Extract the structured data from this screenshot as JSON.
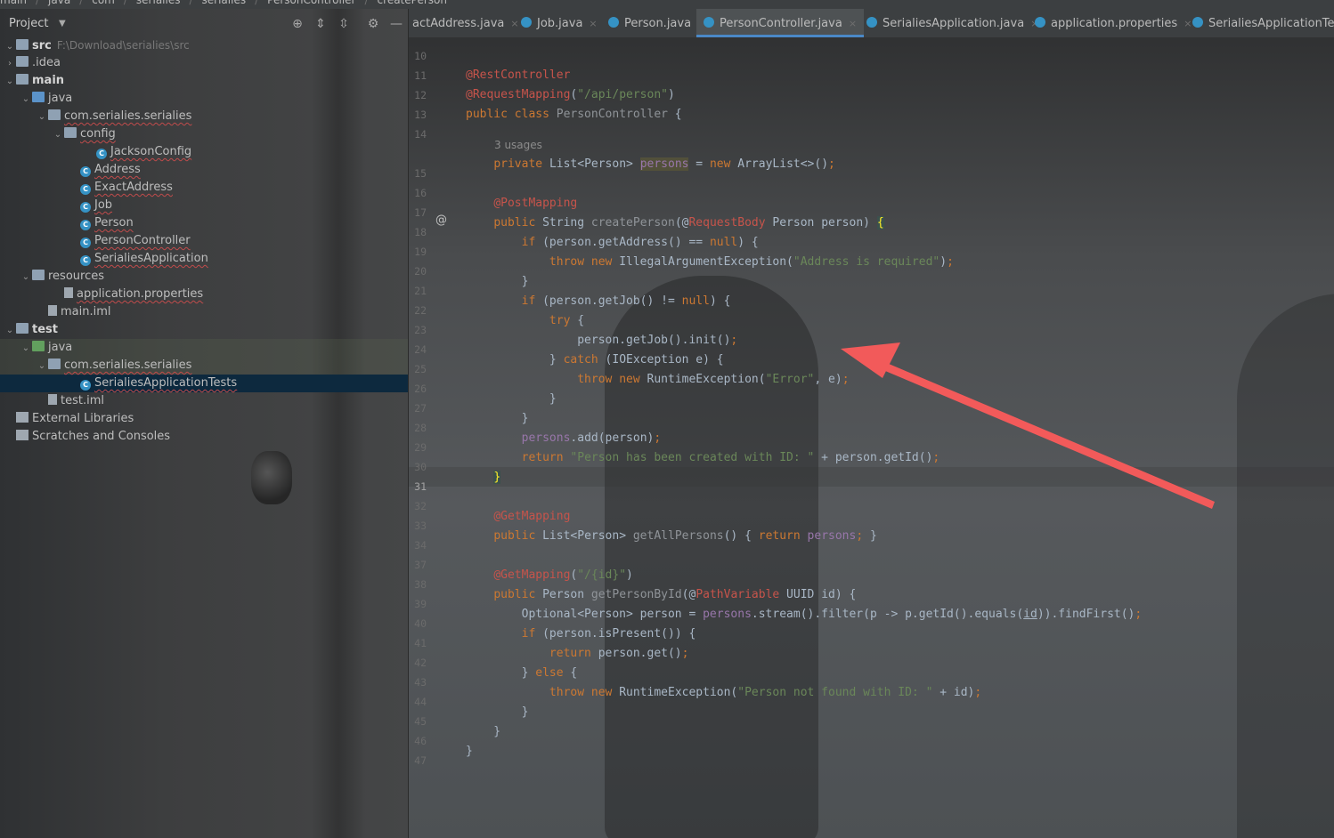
{
  "breadcrumbs": [
    "main",
    "java",
    "com",
    "serialies",
    "serialies",
    "PersonController",
    "createPerson"
  ],
  "project_panel": {
    "title": "Project",
    "tree": [
      {
        "label": "src",
        "path": "F:\\Download\\serialies\\src",
        "indent": 0,
        "arrow": "expanded",
        "icon": "src-folder-icon",
        "bold": true
      },
      {
        "label": ".idea",
        "indent": 0,
        "arrow": "collapsed",
        "icon": "folder-icon"
      },
      {
        "label": "main",
        "indent": 0,
        "arrow": "expanded",
        "icon": "folder-icon",
        "bold": true
      },
      {
        "label": "java",
        "indent": 1,
        "arrow": "expanded",
        "icon": "java-folder-icon"
      },
      {
        "label": "com.serialies.serialies",
        "indent": 2,
        "arrow": "expanded",
        "icon": "package-icon"
      },
      {
        "label": "config",
        "indent": 3,
        "arrow": "expanded",
        "icon": "package-icon"
      },
      {
        "label": "JacksonConfig",
        "indent": 5,
        "icon": "class-icon"
      },
      {
        "label": "Address",
        "indent": 4,
        "icon": "class-icon"
      },
      {
        "label": "ExactAddress",
        "indent": 4,
        "icon": "class-icon"
      },
      {
        "label": "Job",
        "indent": 4,
        "icon": "class-icon"
      },
      {
        "label": "Person",
        "indent": 4,
        "icon": "class-icon"
      },
      {
        "label": "PersonController",
        "indent": 4,
        "icon": "class-icon"
      },
      {
        "label": "SerialiesApplication",
        "indent": 4,
        "icon": "spring-class-icon"
      },
      {
        "label": "resources",
        "indent": 1,
        "arrow": "expanded",
        "icon": "resources-folder-icon"
      },
      {
        "label": "application.properties",
        "indent": 3,
        "icon": "properties-file-icon"
      },
      {
        "label": "main.iml",
        "indent": 2,
        "icon": "iml-file-icon"
      },
      {
        "label": "test",
        "indent": 0,
        "arrow": "expanded",
        "icon": "folder-icon",
        "bold": true
      },
      {
        "label": "java",
        "indent": 1,
        "arrow": "expanded",
        "icon": "test-folder-icon"
      },
      {
        "label": "com.serialies.serialies",
        "indent": 2,
        "arrow": "expanded",
        "icon": "package-icon"
      },
      {
        "label": "SerialiesApplicationTests",
        "indent": 4,
        "icon": "class-icon",
        "selected": true
      },
      {
        "label": "test.iml",
        "indent": 2,
        "icon": "iml-file-icon"
      },
      {
        "label": "External Libraries",
        "indent": 0,
        "icon": "library-icon"
      },
      {
        "label": "Scratches and Consoles",
        "indent": 0,
        "icon": "scratches-icon"
      }
    ]
  },
  "tabs": [
    {
      "label": "actAddress.java",
      "icon": false
    },
    {
      "label": "Job.java",
      "icon": true
    },
    {
      "label": "Person.java",
      "icon": true
    },
    {
      "label": "PersonController.java",
      "icon": true,
      "active": true
    },
    {
      "label": "SerialiesApplication.java",
      "icon": true
    },
    {
      "label": "application.properties",
      "icon": true
    },
    {
      "label": "SerialiesApplicationTests",
      "icon": true
    }
  ],
  "editor": {
    "line_numbers": [
      "10",
      "11",
      "12",
      "13",
      "14",
      "",
      "15",
      "16",
      "17",
      "18",
      "19",
      "20",
      "21",
      "22",
      "23",
      "24",
      "25",
      "26",
      "27",
      "28",
      "29",
      "30",
      "31",
      "32",
      "33",
      "34",
      "37",
      "38",
      "39",
      "40",
      "41",
      "42",
      "43",
      "44",
      "45",
      "46",
      "47"
    ],
    "current_line": "31",
    "usages_hint": "3 usages",
    "gutter_marker": "@"
  },
  "accent_colors": {
    "keyword": "#cc7832",
    "annotation": "#c7544b",
    "string": "#6a8759",
    "field": "#9876aa",
    "arrow": "#f25a5a"
  }
}
